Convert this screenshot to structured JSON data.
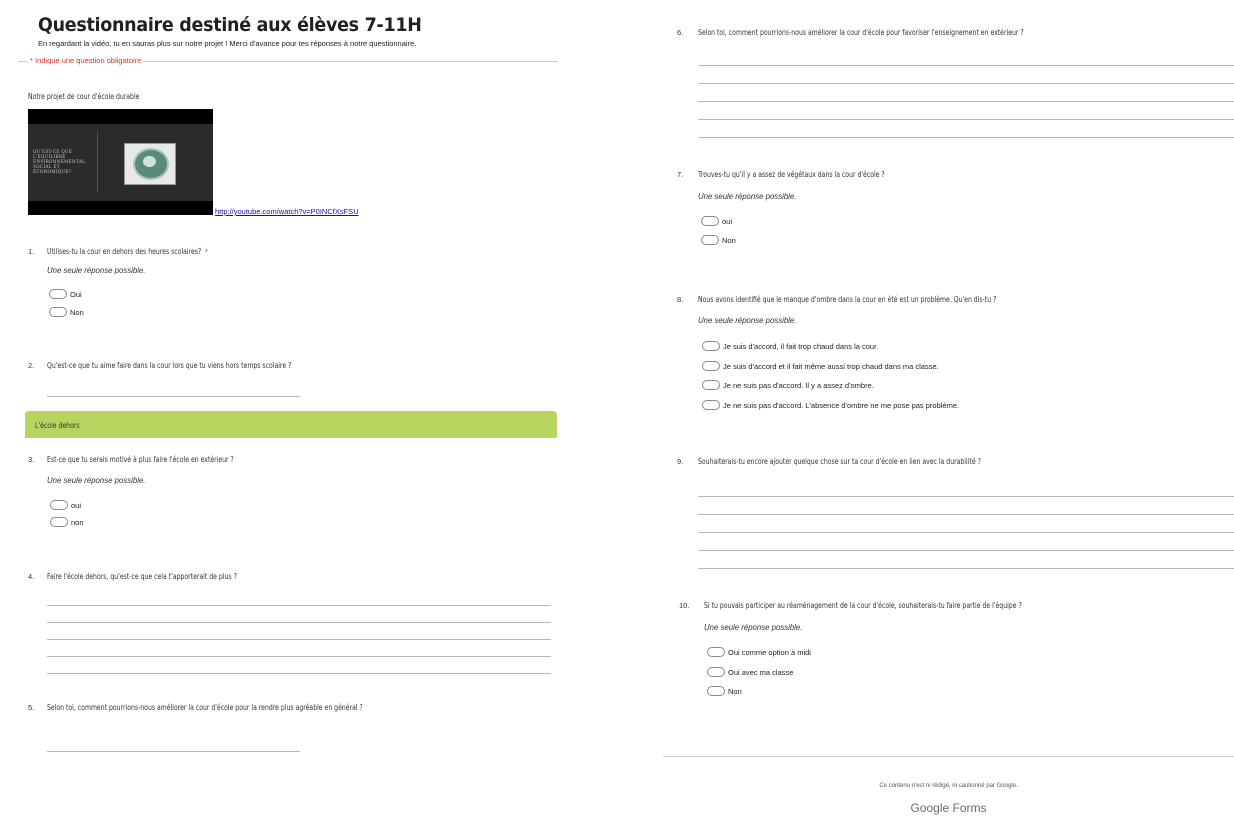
{
  "header": {
    "title": "Questionnaire destiné aux élèves 7-11H",
    "subtitle": "En regardant la vidéo, tu en sauras plus sur notre projet ! Merci d'avance pour tes réponses à notre questionnaire.",
    "required_note": "* Indique une question obligatoire"
  },
  "video_block": {
    "label": "Notre projet de cour d'école durable",
    "thumbnail_text": "QU'EST-CE QUE L'ÉQUILIBRE ENVIRONNEMENTAL, SOCIAL ET ÉCONOMIQUE?",
    "link": "http://youtube.com/watch?v=P0INCfXsFSU"
  },
  "hint": "Une seule réponse possible.",
  "section": {
    "label": "L'école dehors",
    "color": "#b7d55e"
  },
  "questions": {
    "q1": {
      "num": "1.",
      "text": "Utilises-tu la cour en dehors des heures scolaires?",
      "required": "*",
      "options": [
        "Oui",
        "Non"
      ]
    },
    "q2": {
      "num": "2.",
      "text": "Qu'est-ce que tu aime faire dans la cour lors que tu viens hors temps scolaire ?"
    },
    "q3": {
      "num": "3.",
      "text": "Est-ce que tu serais motivé à plus faire l'école en extérieur ?",
      "options": [
        "oui",
        "non"
      ]
    },
    "q4": {
      "num": "4.",
      "text": "Faire l'école dehors, qu'est-ce que cela t'apporterait de plus ?"
    },
    "q5": {
      "num": "5.",
      "text": "Selon toi, comment pourrions-nous améliorer la cour d'école pour la rendre plus agréable en général ?"
    },
    "q6": {
      "num": "6.",
      "text": "Selon toi, comment pourrions-nous améliorer la cour d'école pour favoriser l'enseignement en extérieur ?"
    },
    "q7": {
      "num": "7.",
      "text": "Trouves-tu qu'il y a assez de végétaux dans la cour d'école ?",
      "options": [
        "oui",
        "Non"
      ]
    },
    "q8": {
      "num": "8.",
      "text": "Nous avons identifié que le manque d'ombre dans la cour en été est un problème. Qu'en dis-tu ?",
      "options": [
        "Je suis d'accord, il fait trop chaud dans la cour.",
        "Je suis d'accord et il fait même aussi trop chaud dans ma classe.",
        "Je ne suis pas d'accord. Il y a assez d'ombre.",
        "Je ne suis pas d'accord. L'absence d'ombre ne me pose pas problème."
      ]
    },
    "q9": {
      "num": "9.",
      "text": "Souhaiterais-tu encore ajouter quelque chose sur ta cour d'école en lien avec la durabilité ?"
    },
    "q10": {
      "num": "10.",
      "text": "Si tu pouvais participer au réaménagement de la cour d'école, souhaiterais-tu faire partie de l'équipe ?",
      "options": [
        "Oui comme option à midi",
        "Oui avec ma classe",
        "Non"
      ]
    }
  },
  "footer": {
    "note": "Ce contenu n'est ni rédigé, ni cautionné par Google.",
    "brand_google": "Google",
    "brand_forms": "Forms"
  }
}
